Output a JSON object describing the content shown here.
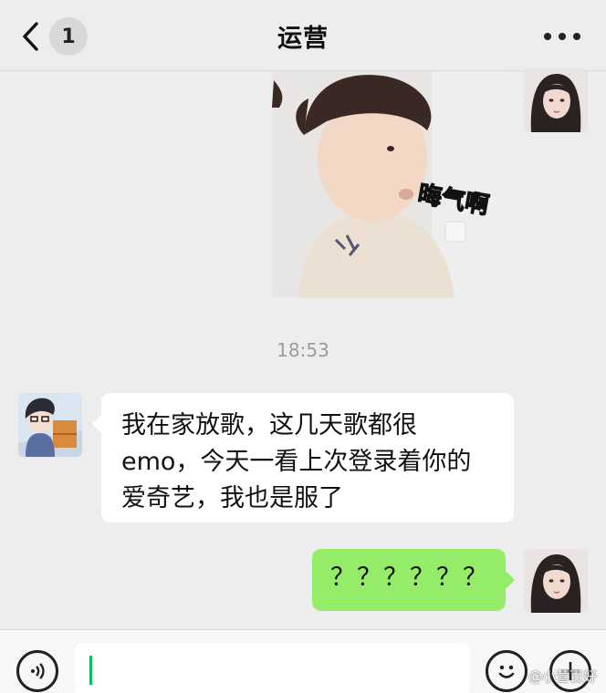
{
  "header": {
    "unread_count": "1",
    "title": "运营"
  },
  "sticker": {
    "caption": "晦气啊"
  },
  "chat": {
    "timestamp": "18:53",
    "messages": [
      {
        "side": "left",
        "lines": [
          "我在家放歌，这几天歌都很",
          "emo，今天一看上次登录着你的",
          "爱奇艺，我也是服了"
        ]
      },
      {
        "side": "right",
        "text": "？？？？？？"
      }
    ]
  },
  "watermark": "@小营百好",
  "colors": {
    "background": "#ededed",
    "sent_bubble": "#95ec69",
    "received_bubble": "#ffffff",
    "caret": "#07c160"
  },
  "icons": [
    "back-chevron-icon",
    "more-icon",
    "voice-icon",
    "emoji-icon",
    "plus-icon"
  ]
}
